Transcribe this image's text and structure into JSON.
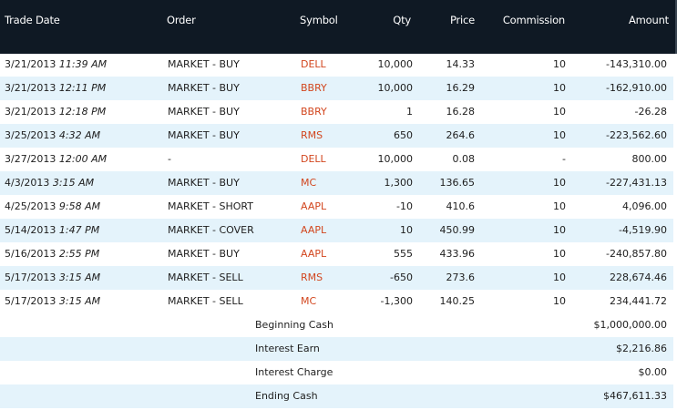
{
  "columns": {
    "trade_date": "Trade Date",
    "order": "Order",
    "symbol": "Symbol",
    "qty": "Qty",
    "price": "Price",
    "commission": "Commission",
    "amount": "Amount"
  },
  "trades": [
    {
      "date": "3/21/2013",
      "time": "11:39 AM",
      "order": "MARKET - BUY",
      "symbol": "DELL",
      "qty": "10,000",
      "price": "14.33",
      "commission": "10",
      "amount": "-143,310.00"
    },
    {
      "date": "3/21/2013",
      "time": "12:11 PM",
      "order": "MARKET - BUY",
      "symbol": "BBRY",
      "qty": "10,000",
      "price": "16.29",
      "commission": "10",
      "amount": "-162,910.00"
    },
    {
      "date": "3/21/2013",
      "time": "12:18 PM",
      "order": "MARKET - BUY",
      "symbol": "BBRY",
      "qty": "1",
      "price": "16.28",
      "commission": "10",
      "amount": "-26.28"
    },
    {
      "date": "3/25/2013",
      "time": "4:32 AM",
      "order": "MARKET - BUY",
      "symbol": "RMS",
      "qty": "650",
      "price": "264.6",
      "commission": "10",
      "amount": "-223,562.60"
    },
    {
      "date": "3/27/2013",
      "time": "12:00 AM",
      "order": "-",
      "symbol": "DELL",
      "qty": "10,000",
      "price": "0.08",
      "commission": "-",
      "amount": "800.00"
    },
    {
      "date": "4/3/2013",
      "time": "3:15 AM",
      "order": "MARKET - BUY",
      "symbol": "MC",
      "qty": "1,300",
      "price": "136.65",
      "commission": "10",
      "amount": "-227,431.13"
    },
    {
      "date": "4/25/2013",
      "time": "9:58 AM",
      "order": "MARKET - SHORT",
      "symbol": "AAPL",
      "qty": "-10",
      "price": "410.6",
      "commission": "10",
      "amount": "4,096.00"
    },
    {
      "date": "5/14/2013",
      "time": "1:47 PM",
      "order": "MARKET - COVER",
      "symbol": "AAPL",
      "qty": "10",
      "price": "450.99",
      "commission": "10",
      "amount": "-4,519.90"
    },
    {
      "date": "5/16/2013",
      "time": "2:55 PM",
      "order": "MARKET - BUY",
      "symbol": "AAPL",
      "qty": "555",
      "price": "433.96",
      "commission": "10",
      "amount": "-240,857.80"
    },
    {
      "date": "5/17/2013",
      "time": "3:15 AM",
      "order": "MARKET - SELL",
      "symbol": "RMS",
      "qty": "-650",
      "price": "273.6",
      "commission": "10",
      "amount": "228,674.46"
    },
    {
      "date": "5/17/2013",
      "time": "3:15 AM",
      "order": "MARKET - SELL",
      "symbol": "MC",
      "qty": "-1,300",
      "price": "140.25",
      "commission": "10",
      "amount": "234,441.72"
    }
  ],
  "summary": [
    {
      "label": "Beginning Cash",
      "value": "$1,000,000.00"
    },
    {
      "label": "Interest Earn",
      "value": "$2,216.86"
    },
    {
      "label": "Interest Charge",
      "value": "$0.00"
    },
    {
      "label": "Ending Cash",
      "value": "$467,611.33"
    }
  ]
}
